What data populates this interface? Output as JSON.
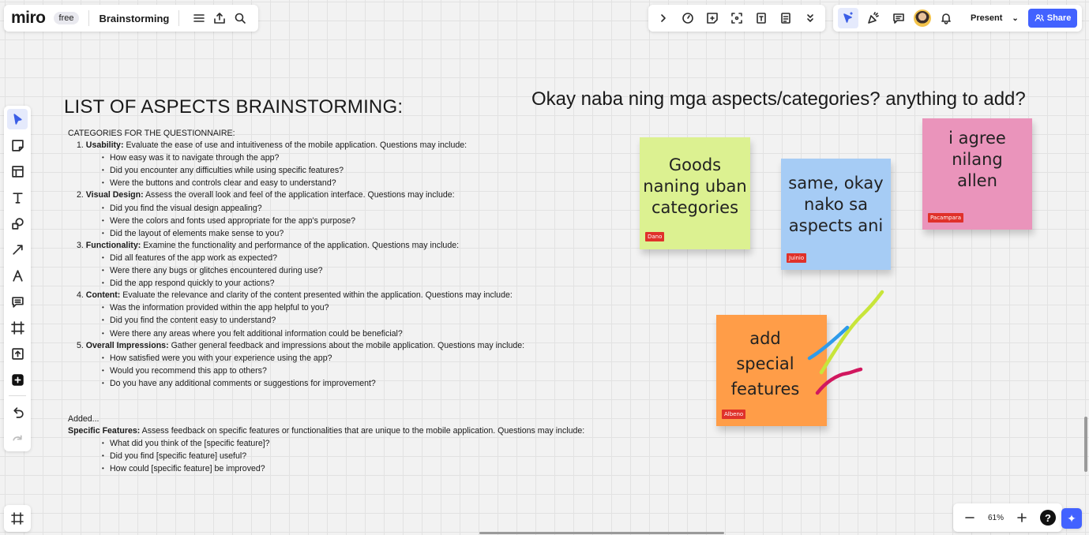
{
  "header": {
    "logo": "miro",
    "plan_badge": "free",
    "board_title": "Brainstorming"
  },
  "topbar": {
    "present_label": "Present",
    "share_label": "Share"
  },
  "board": {
    "heading": "LIST OF ASPECTS BRAINSTORMING:",
    "question": "Okay naba ning mga aspects/categories? anything to add?",
    "doc": {
      "intro": "CATEGORIES FOR THE QUESTIONNAIRE:",
      "categories": [
        {
          "num": "1.",
          "name": "Usability:",
          "desc": "Evaluate the ease of use and intuitiveness of the mobile application. Questions may include:",
          "items": [
            "How easy was it to navigate through the app?",
            "Did you encounter any difficulties while using specific features?",
            "Were the buttons and controls clear and easy to understand?"
          ]
        },
        {
          "num": "2.",
          "name": "Visual Design:",
          "desc": "Assess the overall look and feel of the application interface. Questions may include:",
          "items": [
            "Did you find the visual design appealing?",
            "Were the colors and fonts used appropriate for the app's purpose?",
            "Did the layout of elements make sense to you?"
          ]
        },
        {
          "num": "3.",
          "name": "Functionality:",
          "desc": "Examine the functionality and performance of the application. Questions may include:",
          "items": [
            "Did all features of the app work as expected?",
            "Were there any bugs or glitches encountered during use?",
            "Did the app respond quickly to your actions?"
          ]
        },
        {
          "num": "4.",
          "name": "Content:",
          "desc": "Evaluate the relevance and clarity of the content presented within the application. Questions may include:",
          "items": [
            "Was the information provided within the app helpful to you?",
            "Did you find the content easy to understand?",
            "Were there any areas where you felt additional information could be beneficial?"
          ]
        },
        {
          "num": "5.",
          "name": "Overall Impressions:",
          "desc": "Gather general feedback and impressions about the mobile application. Questions may include:",
          "items": [
            "How satisfied were you with your experience using the app?",
            "Would you recommend this app to others?",
            "Do you have any additional comments or suggestions for improvement?"
          ]
        }
      ],
      "added_label": "Added...",
      "extra": {
        "name": "Specific Features:",
        "desc": "Assess feedback on specific features or functionalities that are unique to the mobile application. Questions may include:",
        "items": [
          "What did you think of the [specific feature]?",
          "Did you find [specific feature] useful?",
          "How could [specific feature] be improved?"
        ]
      }
    },
    "notes": [
      {
        "lines": [
          "Goods",
          "naning uban",
          "categories"
        ],
        "author": "Dano",
        "color": "#dcf191"
      },
      {
        "lines": [
          "same, okay",
          "nako sa",
          "aspects ani"
        ],
        "author": "Juinio",
        "color": "#a6ccf5"
      },
      {
        "lines": [
          "i agree",
          "nilang",
          "allen"
        ],
        "author": "Pacampara",
        "color": "#ea94bb"
      },
      {
        "lines": [
          "add",
          "special",
          "features"
        ],
        "author": "Albeno",
        "color": "#ff9d48"
      }
    ]
  },
  "zoom": {
    "level": "61%",
    "help": "?"
  },
  "colors": {
    "accent": "#4262ff",
    "author_tag": "#e0312a",
    "stroke_green": "#c8e53a",
    "stroke_blue": "#2f9bea",
    "stroke_pink": "#d1185f"
  }
}
